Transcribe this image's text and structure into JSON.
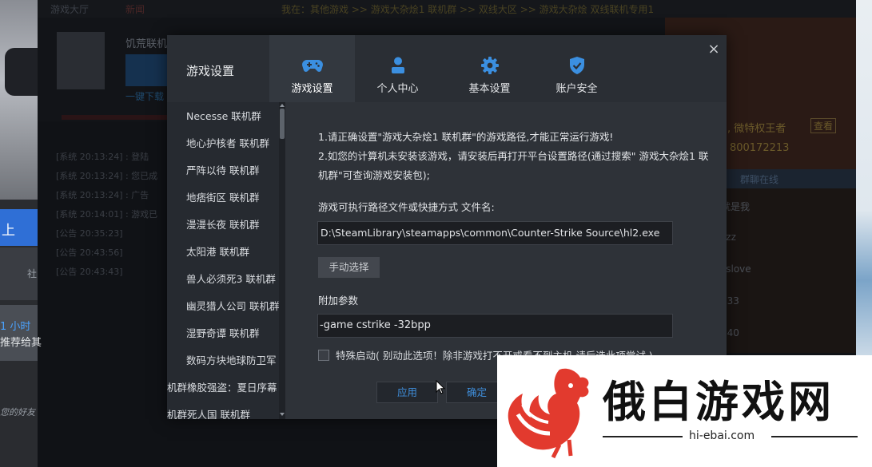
{
  "background": {
    "tabs": [
      "游戏大厅",
      "新闻"
    ],
    "breadcrumb": "我在：其他游戏 >> 游戏大杂烩1 联机群 >> 双线大区 >> 游戏大杂烩 双线联机专用1",
    "room_name": "饥荒联机",
    "download_text": "一键下载",
    "left_blue_text": "上",
    "left_social_text": "社",
    "news_time": "1 小时",
    "news_title": "推荐给其",
    "friends_hint": "您的好友",
    "log_lines": [
      "[系统 20:13:24] : 登陆",
      "[系统 20:13:24] : 您已成",
      "[系统 20:13:24] : 广告",
      "[系统 20:14:01] : 游戏已",
      "[公告 20:35:23]",
      "[公告 20:43:56]",
      "[公告 20:43:43]"
    ],
    "right_member_text": "会员, 微特权王者",
    "right_view_btn": "查看",
    "right_qq": "QQ: 800172213",
    "right_online": "群聊在线",
    "right_list": [
      "就是我",
      "zzz",
      "sslove",
      "233",
      "840"
    ]
  },
  "dialog": {
    "title": "游戏设置",
    "close_glyph": "×",
    "tabs": [
      {
        "label": "游戏设置",
        "icon": "gamepad-icon",
        "active": true
      },
      {
        "label": "个人中心",
        "icon": "user-icon",
        "active": false
      },
      {
        "label": "基本设置",
        "icon": "gear-icon",
        "active": false
      },
      {
        "label": "账户安全",
        "icon": "shield-check-icon",
        "active": false
      }
    ],
    "side_items": [
      "Necesse 联机群",
      "地心护核者 联机群",
      "严阵以待 联机群",
      "地痞街区 联机群",
      "漫漫长夜 联机群",
      "太阳港 联机群",
      "兽人必须死3 联机群",
      "幽灵猎人公司 联机群",
      "湿野奇谭 联机群",
      "数码方块地球防卫军 联",
      "机群橡胶强盗：夏日序幕 联",
      "机群死人国 联机群"
    ],
    "notice_line1": "1.请正确设置\"游戏大杂烩1 联机群\"的游戏路径,才能正常运行游戏!",
    "notice_line2": "2.如您的计算机未安装该游戏，请安装后再打开平台设置路径(通过搜索\" 游戏大杂烩1 联机群\"可查询游戏安装包);",
    "path_label": "游戏可执行路径文件或快捷方式 文件名:",
    "path_value": "D:\\SteamLibrary\\steamapps\\common\\Counter-Strike Source\\hl2.exe",
    "manual_button": "手动选择",
    "args_label": "附加参数",
    "args_value": "-game cstrike -32bpp",
    "special_launch_checked": false,
    "special_launch_label": "特殊启动( 别动此选项！除非游戏打不开或看不到主机,请后选此项尝试 )",
    "apply_button": "应用",
    "ok_button": "确定"
  },
  "watermark": {
    "brand": "俄白游戏网",
    "url": "hi-ebai.com"
  },
  "colors": {
    "accent_blue": "#3f8fdc",
    "icon_blue": "#3b8fe0",
    "dialog_bg": "#2b2f35",
    "logo_red": "#e23a2e"
  }
}
